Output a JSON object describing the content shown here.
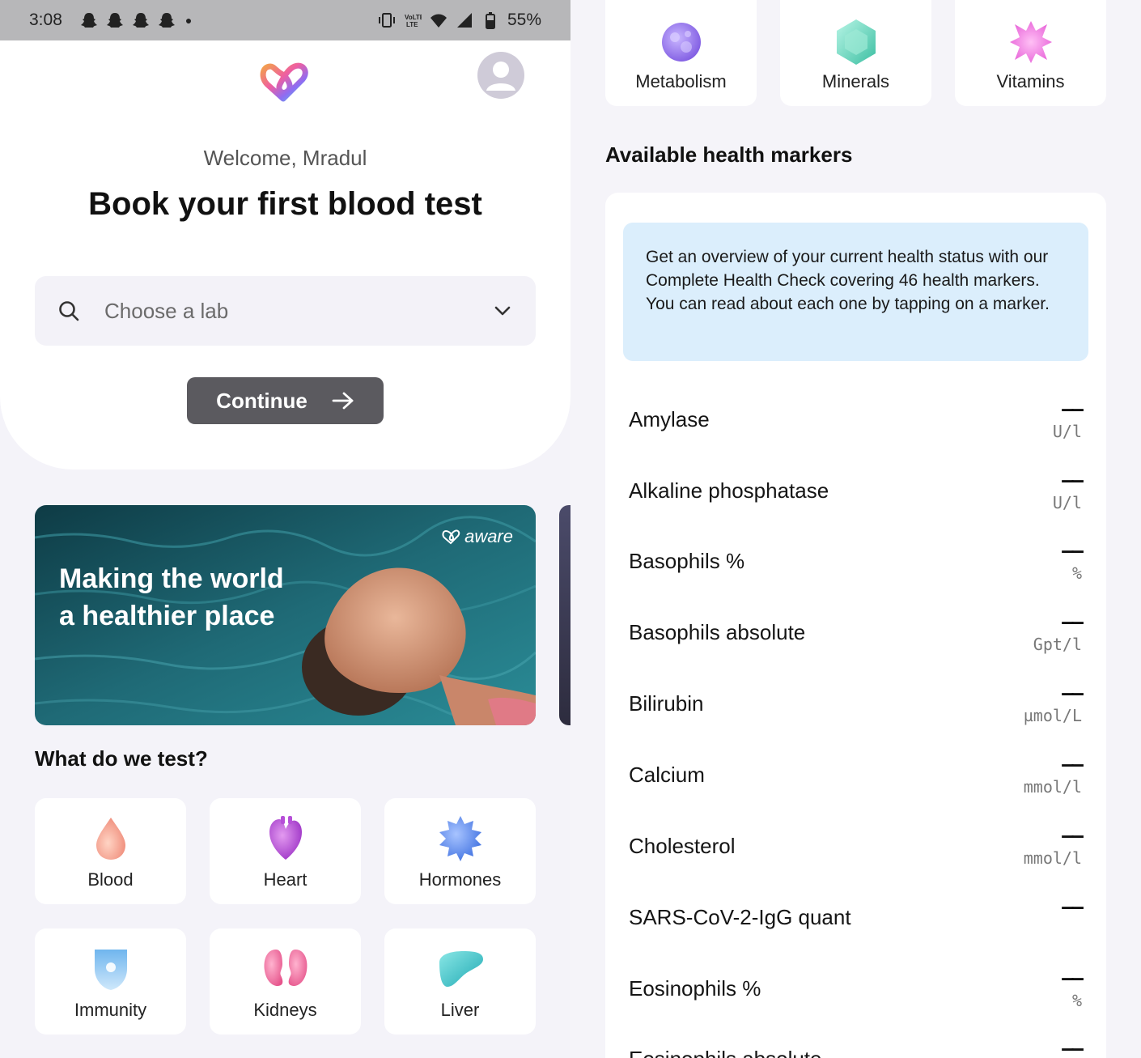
{
  "status_bar": {
    "time": "3:08",
    "battery": "55%"
  },
  "home": {
    "welcome": "Welcome, Mradul",
    "headline": "Book your first blood test",
    "lab_placeholder": "Choose a lab",
    "continue_label": "Continue",
    "banner_text": "Making the world a healthier place",
    "banner_brand": "aware",
    "section_title": "What do we test?",
    "categories": [
      {
        "label": "Blood",
        "icon": "blood-drop-icon",
        "color": "#f4a89a"
      },
      {
        "label": "Heart",
        "icon": "heart-icon",
        "color": "#b64fd8"
      },
      {
        "label": "Hormones",
        "icon": "hormones-icon",
        "color": "#5b8cf0"
      },
      {
        "label": "Immunity",
        "icon": "shield-icon",
        "color": "#8cc8f5"
      },
      {
        "label": "Kidneys",
        "icon": "kidneys-icon",
        "color": "#f07aa6"
      },
      {
        "label": "Liver",
        "icon": "liver-icon",
        "color": "#38c2c8"
      }
    ]
  },
  "markers_page": {
    "top_categories": [
      {
        "label": "Metabolism",
        "icon": "metabolism-icon",
        "color": "#9a7ef0"
      },
      {
        "label": "Minerals",
        "icon": "mineral-gem-icon",
        "color": "#6fd9c0"
      },
      {
        "label": "Vitamins",
        "icon": "vitamins-icon",
        "color": "#f07ae0"
      }
    ],
    "section_title": "Available health markers",
    "info_text": "Get an overview of your current health status with our Complete Health Check covering 46 health markers. You can read about each one by tapping on a marker.",
    "markers": [
      {
        "name": "Amylase",
        "value": "——",
        "unit": "U/l"
      },
      {
        "name": "Alkaline phosphatase",
        "value": "——",
        "unit": "U/l"
      },
      {
        "name": "Basophils %",
        "value": "——",
        "unit": "%"
      },
      {
        "name": "Basophils absolute",
        "value": "——",
        "unit": "Gpt/l"
      },
      {
        "name": "Bilirubin",
        "value": "——",
        "unit": "µmol/L"
      },
      {
        "name": "Calcium",
        "value": "——",
        "unit": "mmol/l"
      },
      {
        "name": "Cholesterol",
        "value": "——",
        "unit": "mmol/l"
      },
      {
        "name": "SARS-CoV-2-IgG quant",
        "value": "——",
        "unit": ""
      },
      {
        "name": "Eosinophils %",
        "value": "——",
        "unit": "%"
      },
      {
        "name": "Eosinophils absolute",
        "value": "——",
        "unit": ""
      }
    ]
  }
}
